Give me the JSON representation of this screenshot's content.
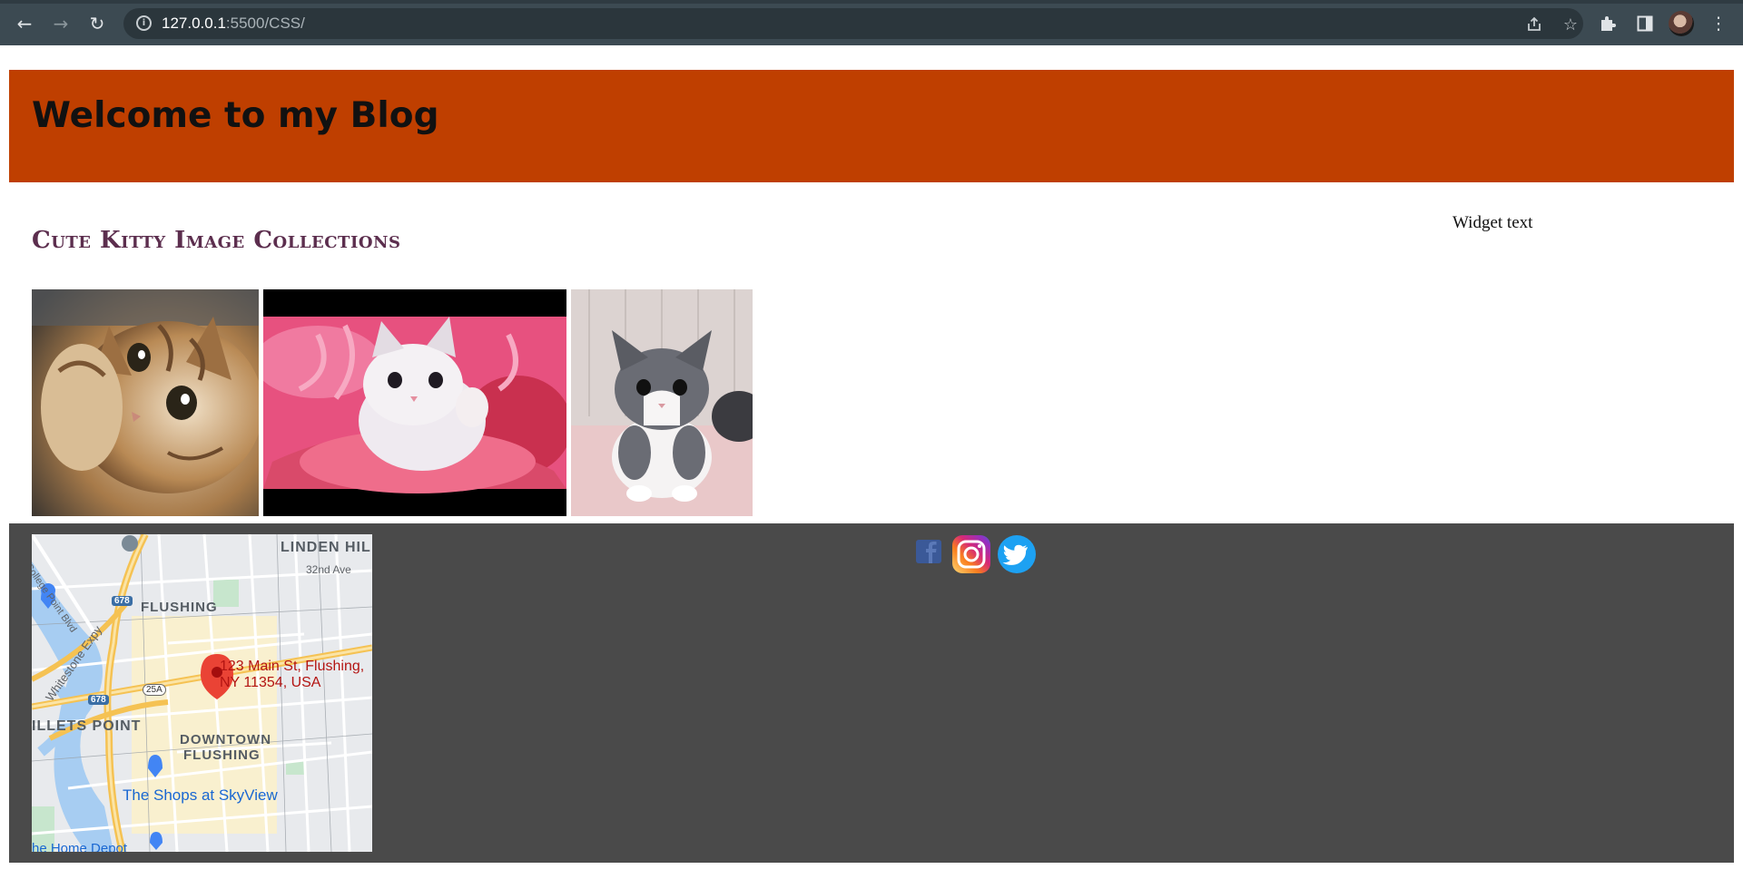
{
  "browser": {
    "url_host": "127.0.0.1",
    "url_path": ":5500/CSS/",
    "icons": [
      "back-icon",
      "forward-icon",
      "reload-icon",
      "info-icon",
      "share-icon",
      "star-icon",
      "extensions-icon",
      "side-panel-icon",
      "profile-avatar",
      "menu-icon"
    ]
  },
  "header": {
    "title": "Welcome to my Blog",
    "background": "#bf3f00"
  },
  "section": {
    "title": "Cute Kitty Image Collections",
    "color": "#5c2e4e"
  },
  "widget": {
    "text": "Widget text"
  },
  "gallery": {
    "images": [
      {
        "name": "kitty-image-1",
        "subject": "tabby kitten raising paw"
      },
      {
        "name": "kitty-image-2",
        "subject": "white kitten in pink basket"
      },
      {
        "name": "kitty-image-3",
        "subject": "grey and white kitten"
      }
    ]
  },
  "footer": {
    "background": "#4a4a4a",
    "map": {
      "areas": {
        "linden_hill": "LINDEN HIL",
        "flushing": "FLUSHING",
        "willets_point": "ILLETS POINT",
        "downtown_1": "DOWNTOWN",
        "downtown_2": "FLUSHING"
      },
      "streets": {
        "ave_32": "32nd Ave",
        "college_point": "College Point Blvd",
        "whitestone": "Whitestone Expy"
      },
      "highway_shields": {
        "i678_top": "678",
        "i678_bottom": "678",
        "rt25a": "25A"
      },
      "address": "123 Main St, Flushing,\nNY 11354, USA",
      "shops": "The Shops at SkyView",
      "home_depot": "he Home Depot"
    },
    "social_icons": [
      "facebook-icon",
      "instagram-icon",
      "twitter-icon"
    ]
  }
}
